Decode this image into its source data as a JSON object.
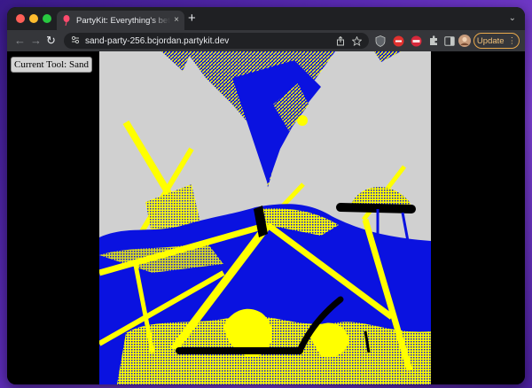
{
  "tab": {
    "title": "PartyKit: Everything's better with friends",
    "favicon": "balloon-icon",
    "close_glyph": "×",
    "new_tab_glyph": "+",
    "tab_search_glyph": "⌄"
  },
  "toolbar": {
    "back_glyph": "←",
    "forward_glyph": "→",
    "reload_glyph": "↻",
    "url": "sand-party-256.bcjordan.partykit.dev",
    "update_label": "Update",
    "menu_glyph": "⋮"
  },
  "page": {
    "current_tool_label": "Current Tool: Sand",
    "colors": {
      "background": "#d0d0d0",
      "water": "#0a12e0",
      "sand": "#ffff00",
      "wall": "#000000"
    }
  }
}
